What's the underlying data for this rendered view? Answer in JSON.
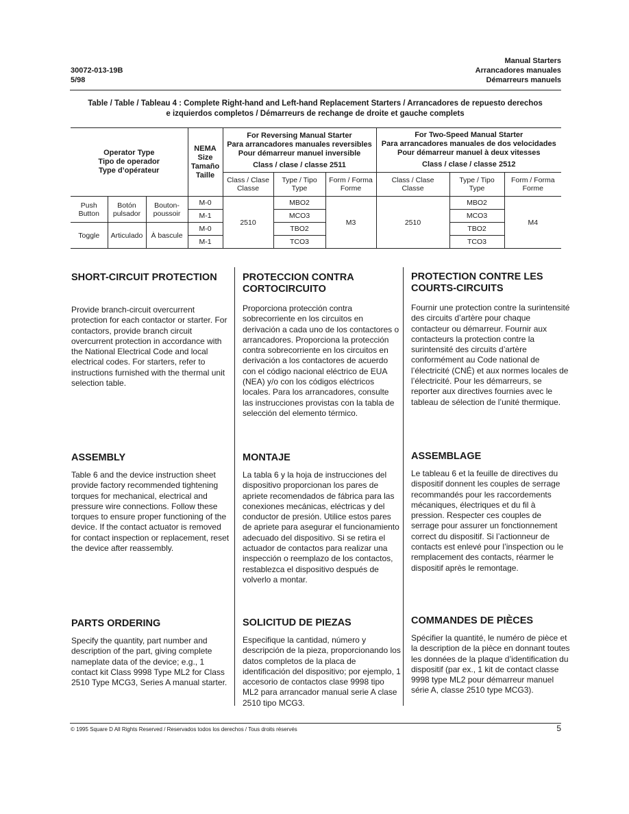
{
  "header": {
    "doc_number": "30072-013-19B",
    "date": "5/98",
    "title_en": "Manual Starters",
    "title_es": "Arrancadores manuales",
    "title_fr": "Démarreurs manuels"
  },
  "table": {
    "caption_line1": "Table / Table / Tableau 4 : Complete Right-hand and Left-hand Replacement Starters / Arrancadores de repuesto derechos",
    "caption_line2": "e izquierdos completos / Démarreurs de rechange de droite et gauche complets",
    "operator_header": [
      "Operator Type",
      "Tipo de operador",
      "Type d’opérateur"
    ],
    "nema_header": [
      "NEMA",
      "Size",
      "Tamaño",
      "Taille"
    ],
    "reversing": {
      "title": [
        "For Reversing Manual Starter",
        "Para arrancadores manuales reversibles",
        "Pour démarreur manuel inversible"
      ],
      "class_label": "Class / clase / classe 2511",
      "sub_headers": [
        [
          "Class / Clase",
          "Classe"
        ],
        [
          "Type / Tipo",
          "Type"
        ],
        [
          "Form / Forma",
          "Forme"
        ]
      ],
      "class_value": "2510",
      "form_value": "M3"
    },
    "two_speed": {
      "title": [
        "For Two-Speed Manual Starter",
        "Para arrancadores manuales de dos velocidades",
        "Pour démarreur manuel à deux vitesses"
      ],
      "class_label": "Class / clase / classe 2512",
      "sub_headers": [
        [
          "Class / Clase",
          "Classe"
        ],
        [
          "Type / Tipo",
          "Type"
        ],
        [
          "Form / Forma",
          "Forme"
        ]
      ],
      "class_value": "2510",
      "form_value": "M4"
    },
    "operators": [
      {
        "en": [
          "Push",
          "Button"
        ],
        "es": [
          "Botón",
          "pulsador"
        ],
        "fr": [
          "Bouton-",
          "poussoir"
        ]
      },
      {
        "en": [
          "Toggle"
        ],
        "es": [
          "Articulado"
        ],
        "fr": [
          "À bascule"
        ]
      }
    ],
    "rows": [
      {
        "size": "M-0",
        "rev_type": "MBO2",
        "two_type": "MBO2"
      },
      {
        "size": "M-1",
        "rev_type": "MCO3",
        "two_type": "MCO3"
      },
      {
        "size": "M-0",
        "rev_type": "TBO2",
        "two_type": "TBO2"
      },
      {
        "size": "M-1",
        "rev_type": "TCO3",
        "two_type": "TCO3"
      }
    ]
  },
  "sections": {
    "en": [
      {
        "title": "SHORT-CIRCUIT PROTECTION",
        "body": "Provide branch-circuit overcurrent protection for each contactor or starter. For contactors, provide branch circuit overcurrent protection in accordance with the National Electrical Code and local electrical codes. For starters, refer to instructions furnished with the thermal unit selection table."
      },
      {
        "title": "ASSEMBLY",
        "body": "Table 6 and the device instruction sheet provide factory recommended tightening torques for mechanical, electrical and pressure wire connections. Follow these torques to ensure proper functioning of the device. If the contact actuator is removed for contact inspection or replacement, reset the device after reassembly."
      },
      {
        "title": "PARTS ORDERING",
        "body": "Specify the quantity, part number and description of the part, giving complete nameplate data of the device; e.g., 1 contact kit Class 9998 Type ML2 for Class 2510 Type MCG3, Series A manual starter."
      }
    ],
    "es": [
      {
        "title": "PROTECCION CONTRA CORTOCIRCUITO",
        "body": "Proporciona protección contra sobrecorriente en los circuitos en derivación a cada uno de los contactores o arrancadores. Proporciona la protección contra sobrecorriente en los circuitos en derivación a los contactores de acuerdo con el código nacional eléctrico de EUA (NEA) y/o con los códigos eléctricos locales. Para los arrancadores, consulte las instrucciones provistas con la tabla de selección del elemento térmico."
      },
      {
        "title": "MONTAJE",
        "body": "La tabla 6 y la hoja de instrucciones del dispositivo proporcionan los pares de apriete recomendados de fábrica para las conexiones mecánicas, eléctricas y del conductor de presión. Utilice estos pares de apriete para asegurar el funcionamiento adecuado del dispositivo. Si se retira el actuador de contactos para realizar una inspección o reemplazo de los contactos, restablezca el dispositivo después de volverlo a montar."
      },
      {
        "title": "SOLICITUD DE PIEZAS",
        "body": "Especifique la cantidad, número y descripción de la pieza, proporcionando los datos completos de la placa de identificación del dispositivo; por ejemplo, 1 accesorio de contactos clase 9998 tipo ML2 para arrancador manual serie A clase 2510 tipo MCG3."
      }
    ],
    "fr": [
      {
        "title": "PROTECTION CONTRE LES COURTS-CIRCUITS",
        "body": "Fournir une protection contre la surintensité des circuits d’artère pour chaque contacteur ou démarreur. Fournir aux contacteurs la protection contre la surintensité des circuits d’artère conformément au Code national de l’électricité (CNÉ) et aux normes locales de l’électricité. Pour les démarreurs, se reporter aux directives fournies avec le tableau de sélection de l’unité thermique."
      },
      {
        "title": "ASSEMBLAGE",
        "body": "Le tableau 6 et la feuille de directives du dispositif donnent les couples de serrage recommandés pour les raccordements mécaniques, électriques et du fil à pression. Respecter ces couples de serrage pour assurer un fonctionnement correct du dispositif. Si l’actionneur de contacts est enlevé pour l’inspection ou le remplacement des contacts, réarmer le dispositif après le remontage."
      },
      {
        "title": "COMMANDES DE PIÈCES",
        "body": "Spécifier la quantité, le numéro de pièce et la description de la pièce en donnant toutes les données de la plaque d’identification du dispositif (par ex., 1 kit de contact classe 9998 type ML2 pour démarreur manuel série A, classe 2510 type MCG3)."
      }
    ]
  },
  "footer": {
    "copyright": "© 1995 Square D All Rights Reserved / Reservados todos los derechos / Tous droits réservés",
    "page_number": "5"
  }
}
